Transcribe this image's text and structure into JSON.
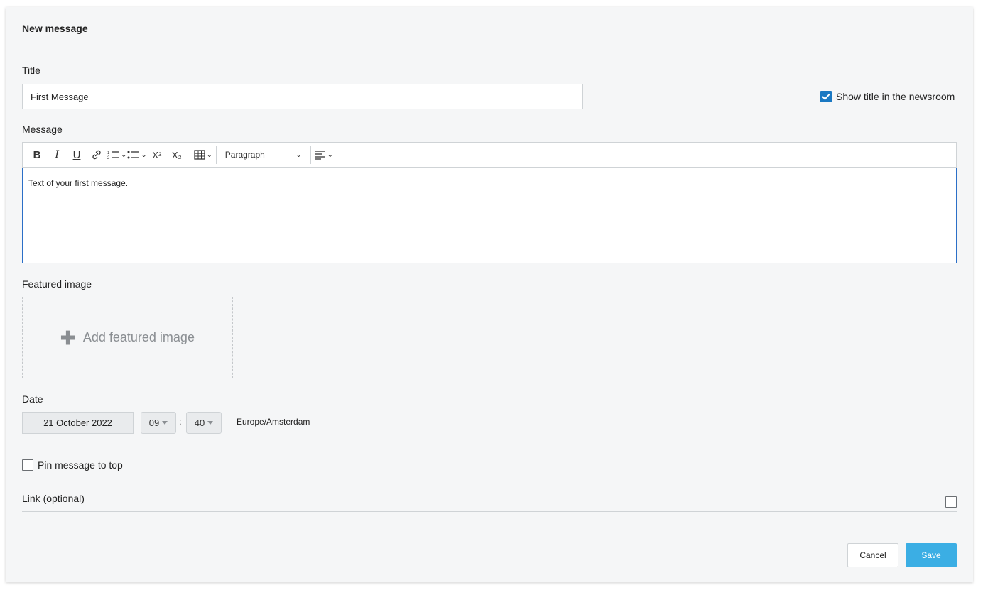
{
  "dialog": {
    "title": "New message"
  },
  "form": {
    "title_label": "Title",
    "title_value": "First Message",
    "show_title_label": "Show title in the newsroom",
    "show_title_checked": true,
    "message_label": "Message",
    "toolbar": {
      "bold": "B",
      "italic": "I",
      "underline": "U",
      "superscript": "X²",
      "subscript": "X₂",
      "paragraph": "Paragraph"
    },
    "message_text": "Text of your first message.",
    "featured_image_label": "Featured image",
    "add_featured_image": "Add featured image",
    "date_label": "Date",
    "date_value": "21 October 2022",
    "hour": "09",
    "minute": "40",
    "time_separator": ":",
    "timezone": "Europe/Amsterdam",
    "pin_label": "Pin message to top",
    "pin_checked": false,
    "link_label": "Link (optional)",
    "link_checked": false
  },
  "actions": {
    "cancel": "Cancel",
    "save": "Save"
  },
  "colors": {
    "accent": "#1a78c2",
    "save_button": "#3baee4",
    "editor_border": "#2b6fc7"
  }
}
